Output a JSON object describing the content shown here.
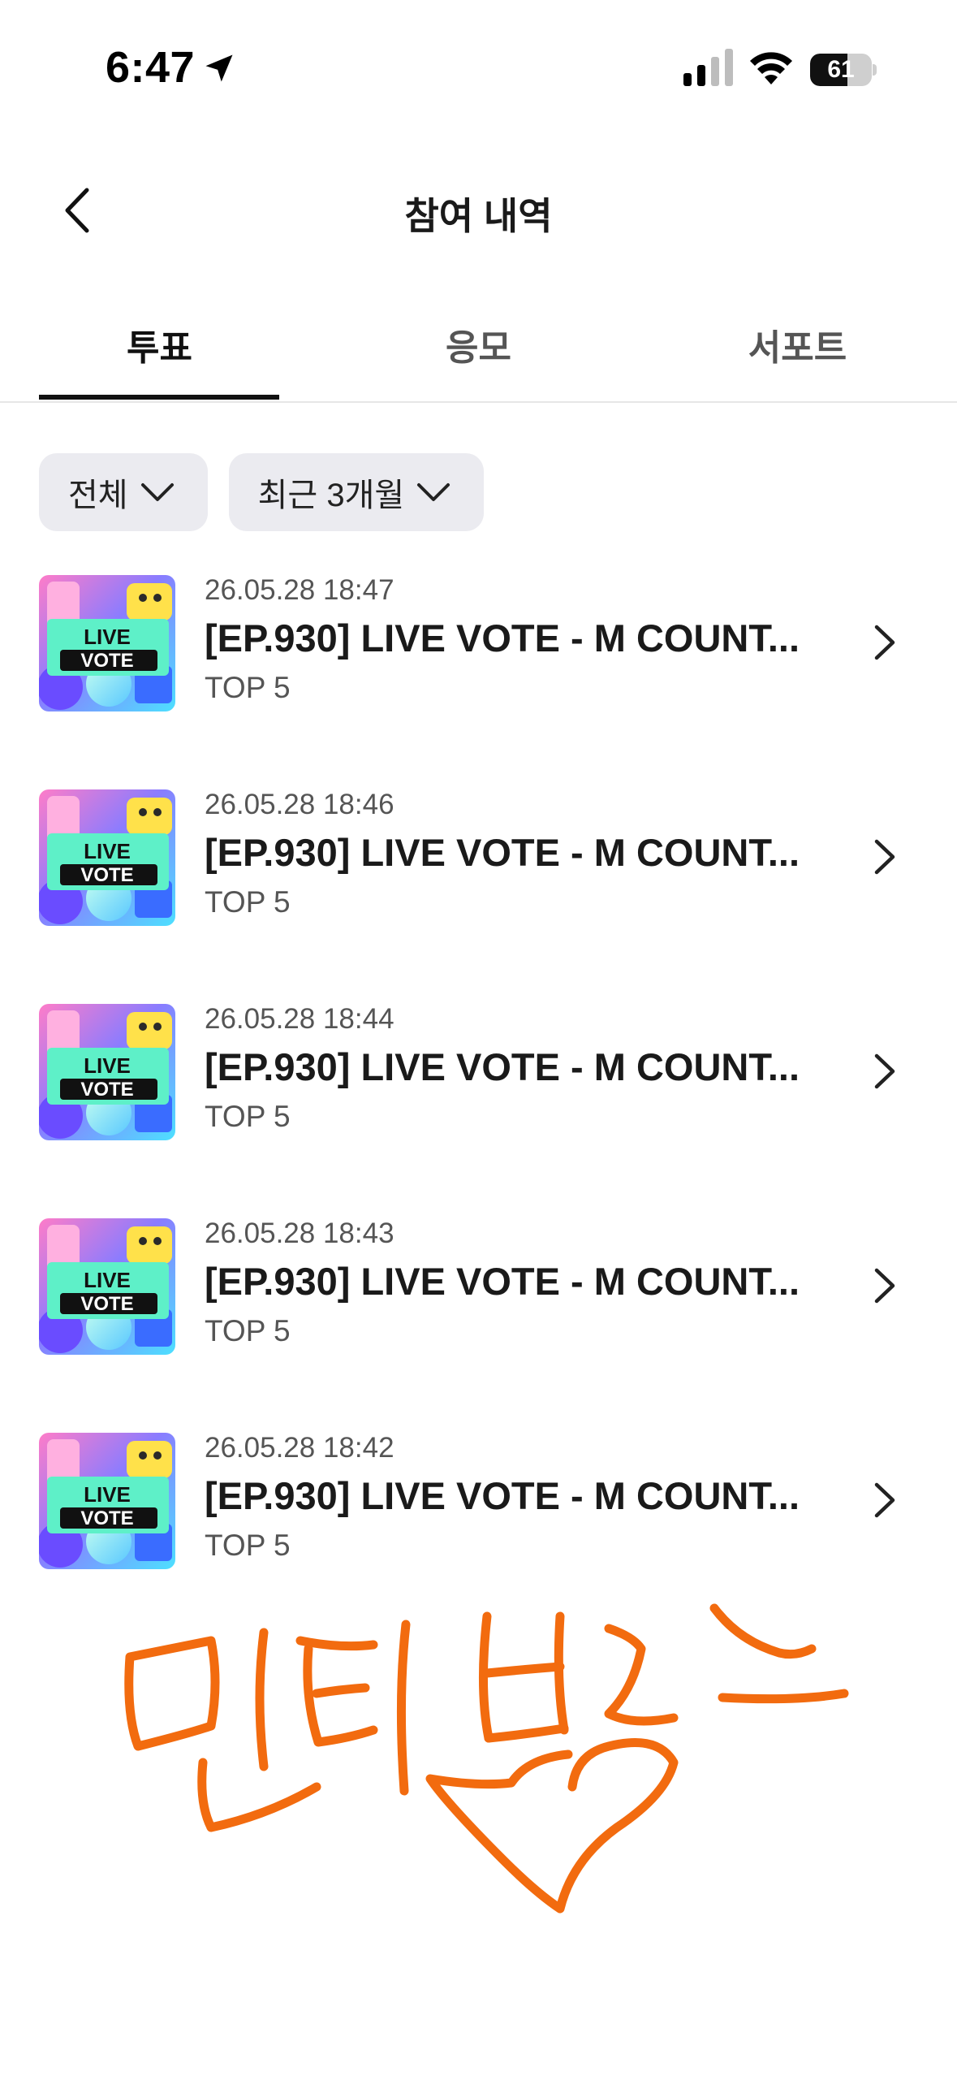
{
  "status_bar": {
    "time": "6:47",
    "battery": "61",
    "battery_level": 0.61
  },
  "header": {
    "title": "참여 내역"
  },
  "tabs": [
    {
      "label": "투표",
      "active": true
    },
    {
      "label": "응모",
      "active": false
    },
    {
      "label": "서포트",
      "active": false
    }
  ],
  "filters": [
    {
      "label": "전체"
    },
    {
      "label": "최근 3개월"
    }
  ],
  "items": [
    {
      "date": "26.05.28 18:47",
      "title": "[EP.930] LIVE VOTE - M COUNT...",
      "subtitle": "TOP 5"
    },
    {
      "date": "26.05.28 18:46",
      "title": "[EP.930] LIVE VOTE - M COUNT...",
      "subtitle": "TOP 5"
    },
    {
      "date": "26.05.28 18:44",
      "title": "[EP.930] LIVE VOTE - M COUNT...",
      "subtitle": "TOP 5"
    },
    {
      "date": "26.05.28 18:43",
      "title": "[EP.930] LIVE VOTE - M COUNT...",
      "subtitle": "TOP 5"
    },
    {
      "date": "26.05.28 18:42",
      "title": "[EP.930] LIVE VOTE - M COUNT...",
      "subtitle": "TOP 5"
    }
  ],
  "thumbnail": {
    "line1": "LIVE",
    "line2": "VOTE"
  },
  "handwriting": {
    "text": "민티 빌즈",
    "color": "#f26b0f"
  },
  "colors": {
    "accent": "#111111",
    "chip_bg": "#ebebf0",
    "divider": "#e6e6e6"
  }
}
